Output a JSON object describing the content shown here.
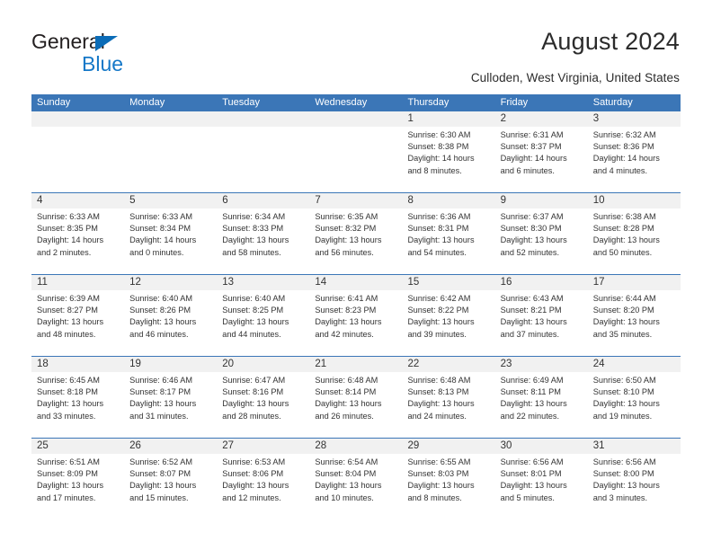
{
  "brand": {
    "name_top": "General",
    "name_bottom": "Blue",
    "accent_color": "#1578c8",
    "triangle_color": "#0b6cb7"
  },
  "header": {
    "title": "August 2024",
    "subtitle": "Culloden, West Virginia, United States"
  },
  "theme": {
    "header_blue": "#3b76b7",
    "number_band": "#f1f1f1",
    "text": "#333333"
  },
  "weekdays": [
    "Sunday",
    "Monday",
    "Tuesday",
    "Wednesday",
    "Thursday",
    "Friday",
    "Saturday"
  ],
  "weeks": [
    [
      {
        "day": "",
        "sunrise": "",
        "sunset": "",
        "daylight": ""
      },
      {
        "day": "",
        "sunrise": "",
        "sunset": "",
        "daylight": ""
      },
      {
        "day": "",
        "sunrise": "",
        "sunset": "",
        "daylight": ""
      },
      {
        "day": "",
        "sunrise": "",
        "sunset": "",
        "daylight": ""
      },
      {
        "day": "1",
        "sunrise": "Sunrise: 6:30 AM",
        "sunset": "Sunset: 8:38 PM",
        "daylight": "Daylight: 14 hours and 8 minutes."
      },
      {
        "day": "2",
        "sunrise": "Sunrise: 6:31 AM",
        "sunset": "Sunset: 8:37 PM",
        "daylight": "Daylight: 14 hours and 6 minutes."
      },
      {
        "day": "3",
        "sunrise": "Sunrise: 6:32 AM",
        "sunset": "Sunset: 8:36 PM",
        "daylight": "Daylight: 14 hours and 4 minutes."
      }
    ],
    [
      {
        "day": "4",
        "sunrise": "Sunrise: 6:33 AM",
        "sunset": "Sunset: 8:35 PM",
        "daylight": "Daylight: 14 hours and 2 minutes."
      },
      {
        "day": "5",
        "sunrise": "Sunrise: 6:33 AM",
        "sunset": "Sunset: 8:34 PM",
        "daylight": "Daylight: 14 hours and 0 minutes."
      },
      {
        "day": "6",
        "sunrise": "Sunrise: 6:34 AM",
        "sunset": "Sunset: 8:33 PM",
        "daylight": "Daylight: 13 hours and 58 minutes."
      },
      {
        "day": "7",
        "sunrise": "Sunrise: 6:35 AM",
        "sunset": "Sunset: 8:32 PM",
        "daylight": "Daylight: 13 hours and 56 minutes."
      },
      {
        "day": "8",
        "sunrise": "Sunrise: 6:36 AM",
        "sunset": "Sunset: 8:31 PM",
        "daylight": "Daylight: 13 hours and 54 minutes."
      },
      {
        "day": "9",
        "sunrise": "Sunrise: 6:37 AM",
        "sunset": "Sunset: 8:30 PM",
        "daylight": "Daylight: 13 hours and 52 minutes."
      },
      {
        "day": "10",
        "sunrise": "Sunrise: 6:38 AM",
        "sunset": "Sunset: 8:28 PM",
        "daylight": "Daylight: 13 hours and 50 minutes."
      }
    ],
    [
      {
        "day": "11",
        "sunrise": "Sunrise: 6:39 AM",
        "sunset": "Sunset: 8:27 PM",
        "daylight": "Daylight: 13 hours and 48 minutes."
      },
      {
        "day": "12",
        "sunrise": "Sunrise: 6:40 AM",
        "sunset": "Sunset: 8:26 PM",
        "daylight": "Daylight: 13 hours and 46 minutes."
      },
      {
        "day": "13",
        "sunrise": "Sunrise: 6:40 AM",
        "sunset": "Sunset: 8:25 PM",
        "daylight": "Daylight: 13 hours and 44 minutes."
      },
      {
        "day": "14",
        "sunrise": "Sunrise: 6:41 AM",
        "sunset": "Sunset: 8:23 PM",
        "daylight": "Daylight: 13 hours and 42 minutes."
      },
      {
        "day": "15",
        "sunrise": "Sunrise: 6:42 AM",
        "sunset": "Sunset: 8:22 PM",
        "daylight": "Daylight: 13 hours and 39 minutes."
      },
      {
        "day": "16",
        "sunrise": "Sunrise: 6:43 AM",
        "sunset": "Sunset: 8:21 PM",
        "daylight": "Daylight: 13 hours and 37 minutes."
      },
      {
        "day": "17",
        "sunrise": "Sunrise: 6:44 AM",
        "sunset": "Sunset: 8:20 PM",
        "daylight": "Daylight: 13 hours and 35 minutes."
      }
    ],
    [
      {
        "day": "18",
        "sunrise": "Sunrise: 6:45 AM",
        "sunset": "Sunset: 8:18 PM",
        "daylight": "Daylight: 13 hours and 33 minutes."
      },
      {
        "day": "19",
        "sunrise": "Sunrise: 6:46 AM",
        "sunset": "Sunset: 8:17 PM",
        "daylight": "Daylight: 13 hours and 31 minutes."
      },
      {
        "day": "20",
        "sunrise": "Sunrise: 6:47 AM",
        "sunset": "Sunset: 8:16 PM",
        "daylight": "Daylight: 13 hours and 28 minutes."
      },
      {
        "day": "21",
        "sunrise": "Sunrise: 6:48 AM",
        "sunset": "Sunset: 8:14 PM",
        "daylight": "Daylight: 13 hours and 26 minutes."
      },
      {
        "day": "22",
        "sunrise": "Sunrise: 6:48 AM",
        "sunset": "Sunset: 8:13 PM",
        "daylight": "Daylight: 13 hours and 24 minutes."
      },
      {
        "day": "23",
        "sunrise": "Sunrise: 6:49 AM",
        "sunset": "Sunset: 8:11 PM",
        "daylight": "Daylight: 13 hours and 22 minutes."
      },
      {
        "day": "24",
        "sunrise": "Sunrise: 6:50 AM",
        "sunset": "Sunset: 8:10 PM",
        "daylight": "Daylight: 13 hours and 19 minutes."
      }
    ],
    [
      {
        "day": "25",
        "sunrise": "Sunrise: 6:51 AM",
        "sunset": "Sunset: 8:09 PM",
        "daylight": "Daylight: 13 hours and 17 minutes."
      },
      {
        "day": "26",
        "sunrise": "Sunrise: 6:52 AM",
        "sunset": "Sunset: 8:07 PM",
        "daylight": "Daylight: 13 hours and 15 minutes."
      },
      {
        "day": "27",
        "sunrise": "Sunrise: 6:53 AM",
        "sunset": "Sunset: 8:06 PM",
        "daylight": "Daylight: 13 hours and 12 minutes."
      },
      {
        "day": "28",
        "sunrise": "Sunrise: 6:54 AM",
        "sunset": "Sunset: 8:04 PM",
        "daylight": "Daylight: 13 hours and 10 minutes."
      },
      {
        "day": "29",
        "sunrise": "Sunrise: 6:55 AM",
        "sunset": "Sunset: 8:03 PM",
        "daylight": "Daylight: 13 hours and 8 minutes."
      },
      {
        "day": "30",
        "sunrise": "Sunrise: 6:56 AM",
        "sunset": "Sunset: 8:01 PM",
        "daylight": "Daylight: 13 hours and 5 minutes."
      },
      {
        "day": "31",
        "sunrise": "Sunrise: 6:56 AM",
        "sunset": "Sunset: 8:00 PM",
        "daylight": "Daylight: 13 hours and 3 minutes."
      }
    ]
  ]
}
